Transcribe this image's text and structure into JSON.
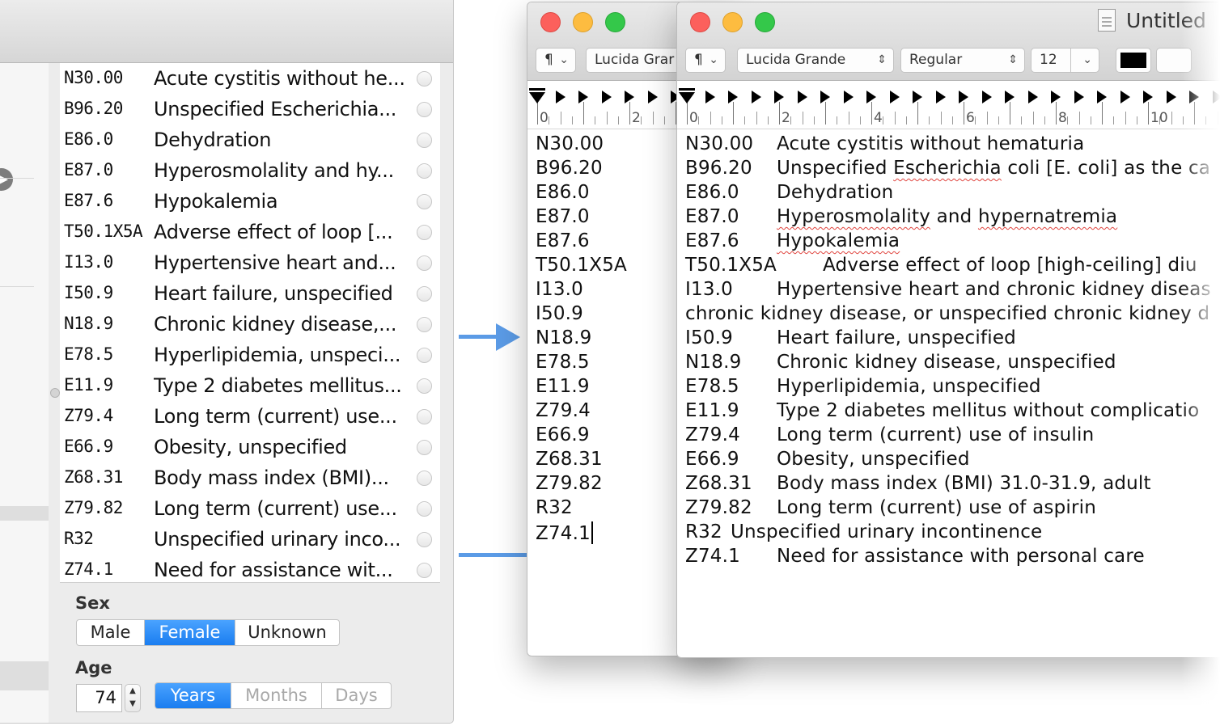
{
  "codes": [
    {
      "code": "N30.00",
      "description": "Acute cystitis without he..."
    },
    {
      "code": "B96.20",
      "description": "Unspecified Escherichia..."
    },
    {
      "code": "E86.0",
      "description": "Dehydration"
    },
    {
      "code": "E87.0",
      "description": "Hyperosmolality and hy..."
    },
    {
      "code": "E87.6",
      "description": "Hypokalemia"
    },
    {
      "code": "T50.1X5A",
      "description": "Adverse effect of loop [..."
    },
    {
      "code": "I13.0",
      "description": "Hypertensive heart and..."
    },
    {
      "code": "I50.9",
      "description": "Heart failure, unspecified"
    },
    {
      "code": "N18.9",
      "description": "Chronic kidney disease,..."
    },
    {
      "code": "E78.5",
      "description": "Hyperlipidemia, unspeci..."
    },
    {
      "code": "E11.9",
      "description": "Type 2 diabetes mellitus..."
    },
    {
      "code": "Z79.4",
      "description": "Long term (current) use..."
    },
    {
      "code": "E66.9",
      "description": "Obesity, unspecified"
    },
    {
      "code": "Z68.31",
      "description": "Body mass index (BMI)..."
    },
    {
      "code": "Z79.82",
      "description": "Long term (current) use..."
    },
    {
      "code": "R32",
      "description": "Unspecified urinary inco..."
    },
    {
      "code": "Z74.1",
      "description": "Need for assistance wit..."
    }
  ],
  "sex": {
    "label": "Sex",
    "options": [
      "Male",
      "Female",
      "Unknown"
    ],
    "selected": "Female"
  },
  "age": {
    "label": "Age",
    "value": "74",
    "units": [
      "Years",
      "Months",
      "Days"
    ],
    "selected_unit": "Years"
  },
  "textedit_back": {
    "font_name": "Lucida Grar",
    "ruler_numbers": [
      "0",
      "2"
    ],
    "lines": [
      "N30.00",
      "B96.20",
      "E86.0",
      "E87.0",
      "E87.6",
      "T50.1X5A",
      "I13.0",
      "I50.9",
      "N18.9",
      "E78.5",
      "E11.9",
      "Z79.4",
      "E66.9",
      "Z68.31",
      "Z79.82",
      "R32",
      "Z74.1"
    ]
  },
  "textedit_front": {
    "title": "Untitled",
    "paragraph_style": "¶",
    "font_name": "Lucida Grande",
    "font_style": "Regular",
    "font_size": "12",
    "ruler_numbers": [
      "0",
      "2",
      "4",
      "6",
      "8",
      "10"
    ],
    "lines": [
      {
        "code": "N30.00",
        "text": "Acute cystitis without hematuria"
      },
      {
        "code": "B96.20",
        "text": "Unspecified Escherichia coli [E. coli] as the ca"
      },
      {
        "code": "E86.0",
        "text": "Dehydration"
      },
      {
        "code": "E87.0",
        "text": "Hyperosmolality and hypernatremia"
      },
      {
        "code": "E87.6",
        "text": "Hypokalemia"
      },
      {
        "code": "T50.1X5A",
        "text": "Adverse effect of loop [high-ceiling] diu"
      },
      {
        "code": "I13.0",
        "text": "Hypertensive heart and chronic kidney diseas"
      },
      {
        "code": "",
        "text": "chronic kidney disease, or unspecified chronic kidney d"
      },
      {
        "code": "I50.9",
        "text": "Heart failure, unspecified"
      },
      {
        "code": "N18.9",
        "text": "Chronic kidney disease, unspecified"
      },
      {
        "code": "E78.5",
        "text": "Hyperlipidemia, unspecified"
      },
      {
        "code": "E11.9",
        "text": "Type 2 diabetes mellitus without complicatio"
      },
      {
        "code": "Z79.4",
        "text": "Long term (current) use of insulin"
      },
      {
        "code": "E66.9",
        "text": "Obesity, unspecified"
      },
      {
        "code": "Z68.31",
        "text": "Body mass index (BMI) 31.0-31.9, adult"
      },
      {
        "code": "Z79.82",
        "text": "Long term (current) use of aspirin"
      },
      {
        "code": "R32",
        "text": "Unspecified urinary incontinence"
      },
      {
        "code": "Z74.1",
        "text": "Need for assistance with personal care"
      }
    ]
  },
  "icons": {
    "paragraph": "paragraph-menu-icon",
    "chevron": "chevron-down-icon",
    "stepper": "up-down-stepper-icon",
    "document": "document-icon",
    "arrow": "arrow-right-icon"
  },
  "colors": {
    "accent": "#1a7df0",
    "arrow": "#5b9be6",
    "close": "#fc605c",
    "minimize": "#fdbc40",
    "zoom": "#34c84a",
    "spellcheck": "#e0443e"
  }
}
